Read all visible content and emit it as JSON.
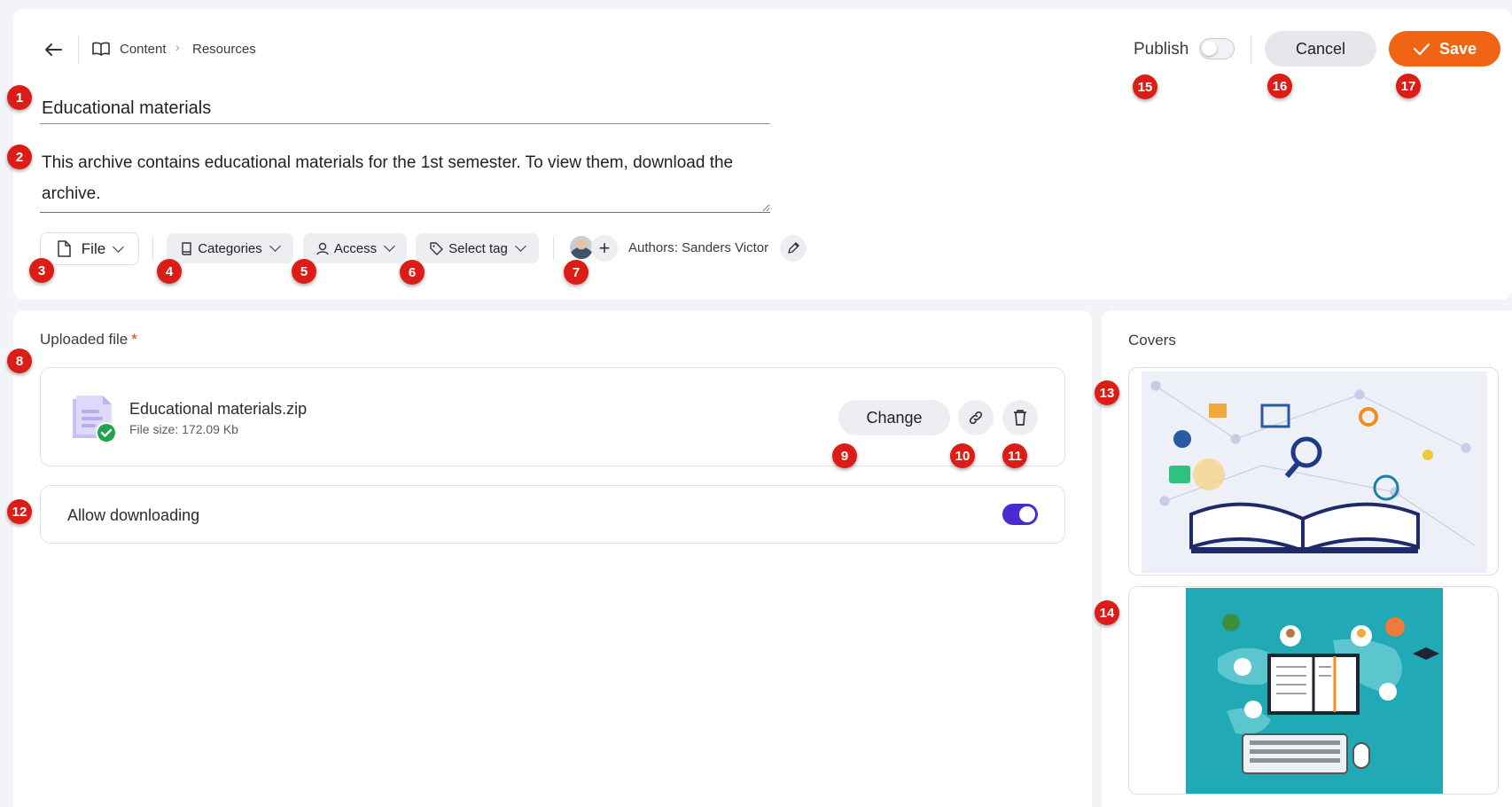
{
  "breadcrumb": {
    "items": [
      "Content",
      "Resources"
    ]
  },
  "form": {
    "title": "Educational materials",
    "description": "This archive contains educational materials for the 1st semester. To view them, download the archive."
  },
  "toolbar": {
    "type_label": "File",
    "categories_label": "Categories",
    "access_label": "Access",
    "tag_label": "Select tag",
    "authors_text": "Authors: Sanders Victor"
  },
  "header_actions": {
    "publish_label": "Publish",
    "publish_on": false,
    "cancel_label": "Cancel",
    "save_label": "Save"
  },
  "uploaded": {
    "section_label": "Uploaded file",
    "required_mark": "*",
    "file_name": "Educational materials.zip",
    "file_size": "File size: 172.09 Kb",
    "change_label": "Change"
  },
  "download": {
    "label": "Allow downloading",
    "enabled": true
  },
  "covers": {
    "label": "Covers"
  },
  "badges": [
    "1",
    "2",
    "3",
    "4",
    "5",
    "6",
    "7",
    "8",
    "9",
    "10",
    "11",
    "12",
    "13",
    "14",
    "15",
    "16",
    "17"
  ],
  "colors": {
    "accent": "#f06414",
    "toggle_on": "#4a2bd1",
    "badge": "#dc1d17"
  }
}
